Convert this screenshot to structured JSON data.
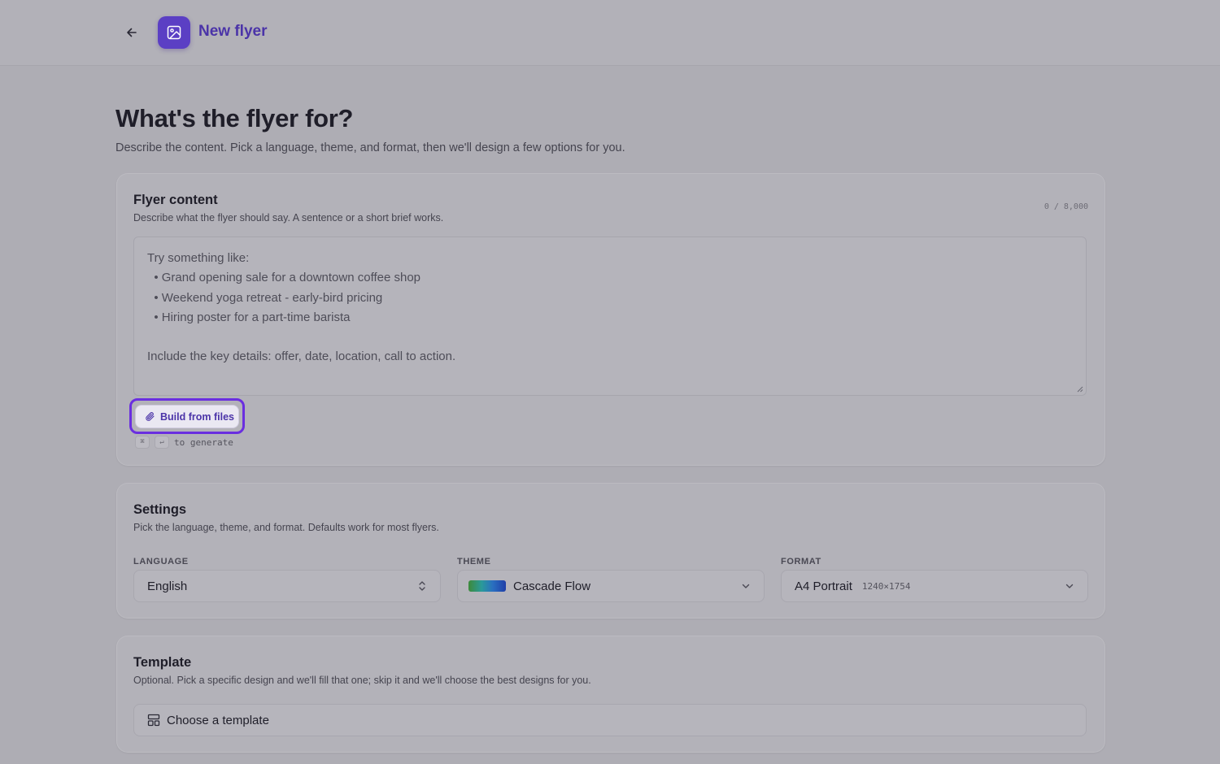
{
  "header": {
    "back_icon": "arrow-left-icon",
    "app_icon": "image-icon",
    "title": "New flyer",
    "accent_color": "#5b3fc4"
  },
  "page": {
    "heading": "What's the flyer for?",
    "subheading": "Describe the content. Pick a language, theme, and format, then we'll design a few options for you."
  },
  "content_card": {
    "title": "Flyer content",
    "description": "Describe what the flyer should say. A sentence or a short brief works.",
    "counter": "0 / 8,000",
    "placeholder_lines": [
      "Try something like:",
      "  • Grand opening sale for a downtown coffee shop",
      "  • Weekend yoga retreat - early-bird pricing",
      "  • Hiring poster for a part-time barista",
      "",
      "Include the key details: offer, date, location, call to action."
    ],
    "build_button_label": "Build from files",
    "build_button_icon": "paperclip-icon",
    "shortcut_keys": [
      "⌘",
      "↵"
    ],
    "shortcut_hint": "to generate"
  },
  "settings_card": {
    "title": "Settings",
    "description": "Pick the language, theme, and format. Defaults work for most flyers.",
    "language": {
      "label": "LANGUAGE",
      "value": "English"
    },
    "theme": {
      "label": "THEME",
      "value": "Cascade Flow",
      "swatch_colors": [
        "#3d8a3a",
        "#2a9a9a",
        "#2a6fc0",
        "#1f3ea8"
      ]
    },
    "format": {
      "label": "FORMAT",
      "value": "A4 Portrait",
      "dimensions": "1240×1754"
    }
  },
  "template_card": {
    "title": "Template",
    "description": "Optional. Pick a specific design and we'll fill that one; skip it and we'll choose the best designs for you.",
    "button_label": "Choose a template",
    "button_icon": "layout-template-icon"
  }
}
